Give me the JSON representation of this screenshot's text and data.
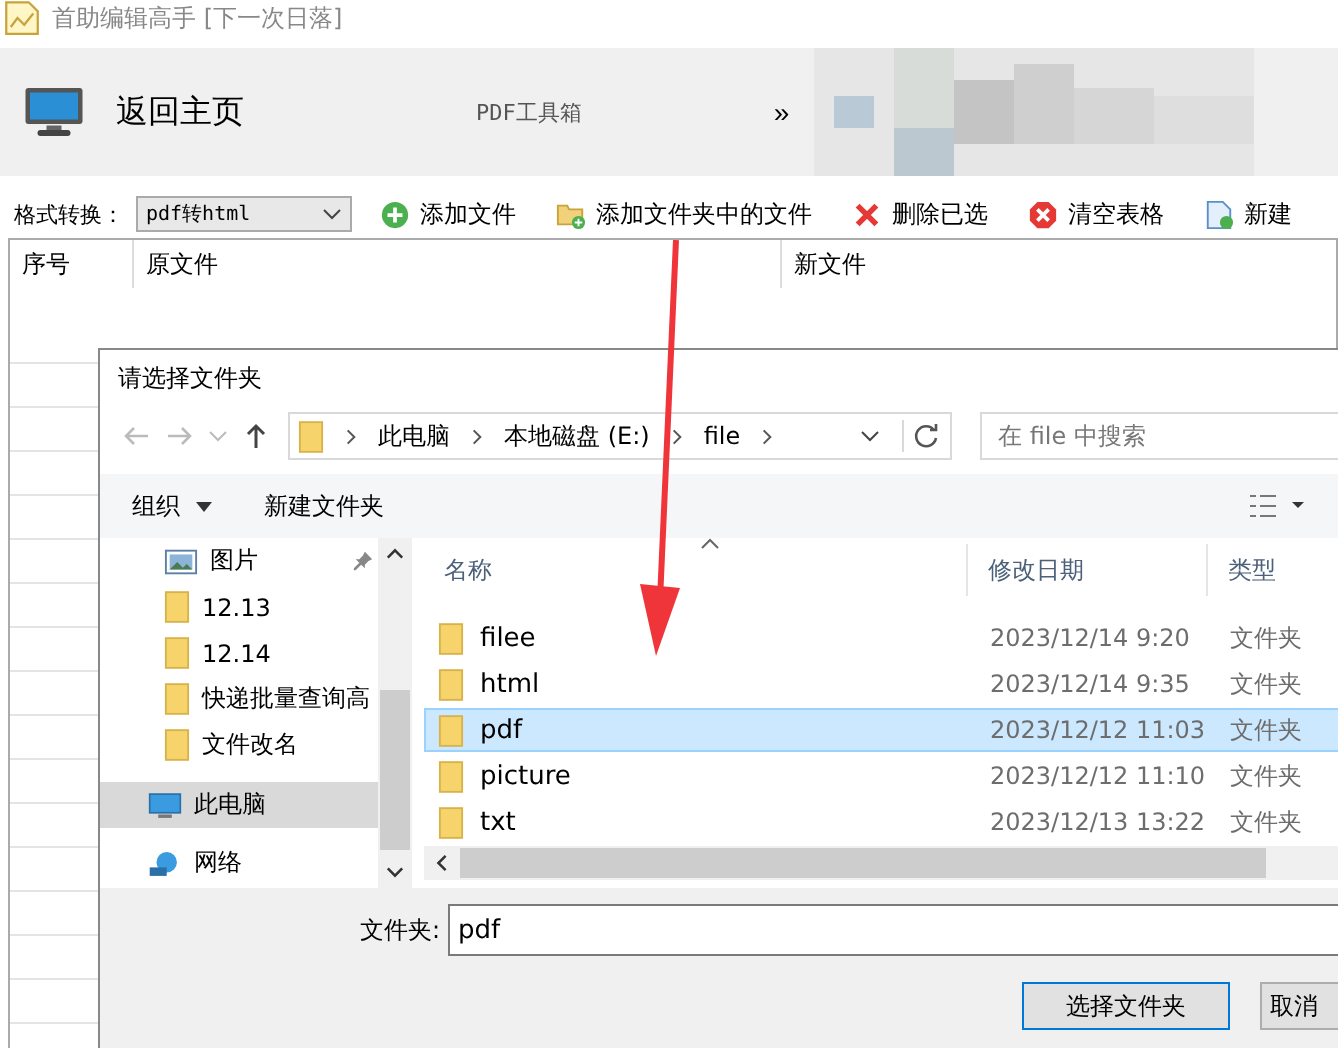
{
  "app": {
    "title": "首助编辑高手 [下一次日落]",
    "home_button": "返回主页",
    "section_title": "PDF工具箱",
    "more": "»",
    "format_label": "格式转换：",
    "format_value": "pdf转html",
    "toolbar": [
      {
        "label": "添加文件",
        "kind": "add"
      },
      {
        "label": "添加文件夹中的文件",
        "kind": "folder"
      },
      {
        "label": "删除已选",
        "kind": "delete"
      },
      {
        "label": "清空表格",
        "kind": "clear"
      },
      {
        "label": "新建",
        "kind": "new"
      }
    ],
    "columns": [
      "序号",
      "原文件",
      "新文件"
    ]
  },
  "dialog": {
    "title": "请选择文件夹",
    "breadcrumb": [
      "此电脑",
      "本地磁盘 (E:)",
      "file"
    ],
    "search": {
      "placeholder": "在 file 中搜索"
    },
    "organize": "组织",
    "new_folder": "新建文件夹",
    "nav": [
      {
        "label": "图片",
        "kind": "pictures",
        "selected": false,
        "pinned": true
      },
      {
        "label": "12.13",
        "kind": "folder",
        "selected": false,
        "pinned": false
      },
      {
        "label": "12.14",
        "kind": "folder",
        "selected": false,
        "pinned": false
      },
      {
        "label": "快递批量查询高",
        "kind": "folder",
        "selected": false,
        "pinned": false
      },
      {
        "label": "文件改名",
        "kind": "folder",
        "selected": false,
        "pinned": false
      },
      {
        "label": "此电脑",
        "kind": "pc",
        "selected": true,
        "pinned": false
      },
      {
        "label": "网络",
        "kind": "network",
        "selected": false,
        "pinned": false
      }
    ],
    "columns": [
      "名称",
      "修改日期",
      "类型"
    ],
    "files": [
      {
        "name": "filee",
        "date": "2023/12/14 9:20",
        "type": "文件夹",
        "selected": false
      },
      {
        "name": "html",
        "date": "2023/12/14 9:35",
        "type": "文件夹",
        "selected": false
      },
      {
        "name": "pdf",
        "date": "2023/12/12 11:03",
        "type": "文件夹",
        "selected": true
      },
      {
        "name": "picture",
        "date": "2023/12/12 11:10",
        "type": "文件夹",
        "selected": false
      },
      {
        "name": "txt",
        "date": "2023/12/13 13:22",
        "type": "文件夹",
        "selected": false
      }
    ],
    "folder_label": "文件夹:",
    "folder_value": "pdf",
    "buttons": [
      "选择文件夹",
      "取消"
    ]
  }
}
